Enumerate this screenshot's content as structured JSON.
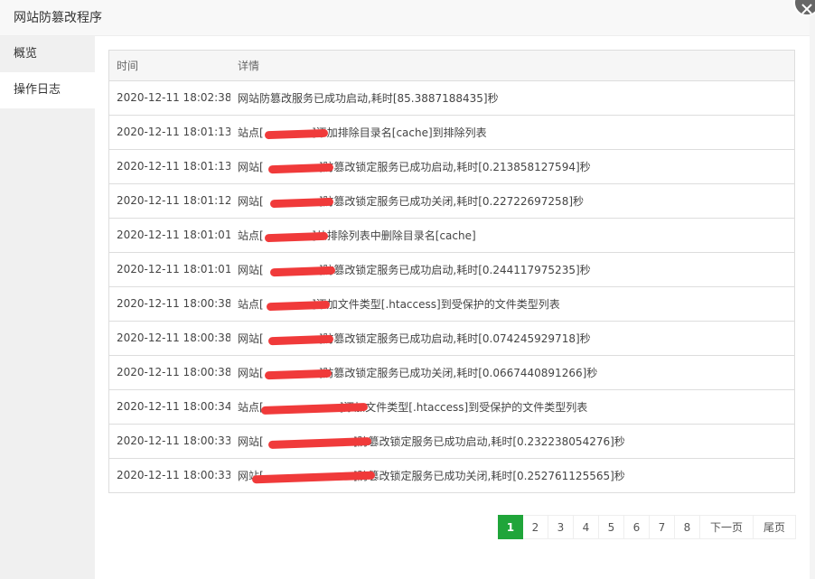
{
  "dialog": {
    "title": "网站防篡改程序"
  },
  "sidebar": {
    "items": [
      {
        "label": "概览",
        "active": false
      },
      {
        "label": "操作日志",
        "active": true
      }
    ]
  },
  "log_table": {
    "headers": {
      "time": "时间",
      "detail": "详情"
    },
    "rows": [
      {
        "time": "2020-12-11 18:02:38",
        "detail": "网站防篡改服务已成功启动,耗时[85.3887188435]秒"
      },
      {
        "time": "2020-12-11 18:01:13",
        "detail": "站点[              ]添加排除目录名[cache]到排除列表"
      },
      {
        "time": "2020-12-11 18:01:13",
        "detail": "网站[                ]防篡改锁定服务已成功启动,耗时[0.213858127594]秒"
      },
      {
        "time": "2020-12-11 18:01:12",
        "detail": "网站[                ]防篡改锁定服务已成功关闭,耗时[0.22722697258]秒"
      },
      {
        "time": "2020-12-11 18:01:01",
        "detail": "站点[              ]从排除列表中删除目录名[cache]"
      },
      {
        "time": "2020-12-11 18:01:01",
        "detail": "网站[                ]防篡改锁定服务已成功启动,耗时[0.244117975235]秒"
      },
      {
        "time": "2020-12-11 18:00:38",
        "detail": "站点[              ]添加文件类型[.htaccess]到受保护的文件类型列表"
      },
      {
        "time": "2020-12-11 18:00:38",
        "detail": "网站[                ]防篡改锁定服务已成功启动,耗时[0.074245929718]秒"
      },
      {
        "time": "2020-12-11 18:00:38",
        "detail": "网站[                ]防篡改锁定服务已成功关闭,耗时[0.0667440891266]秒"
      },
      {
        "time": "2020-12-11 18:00:34",
        "detail": "站点[                      ]添加文件类型[.htaccess]到受保护的文件类型列表"
      },
      {
        "time": "2020-12-11 18:00:33",
        "detail": "网站[                          ]防篡改锁定服务已成功启动,耗时[0.232238054276]秒"
      },
      {
        "time": "2020-12-11 18:00:33",
        "detail": "网站[                          ]防篡改锁定服务已成功关闭,耗时[0.252761125565]秒"
      }
    ]
  },
  "pagination": {
    "pages": [
      "1",
      "2",
      "3",
      "4",
      "5",
      "6",
      "7",
      "8"
    ],
    "current": "1",
    "next_label": "下一页",
    "last_label": "尾页"
  },
  "colors": {
    "accent": "#20a53a",
    "redaction": "#f03a3a"
  }
}
